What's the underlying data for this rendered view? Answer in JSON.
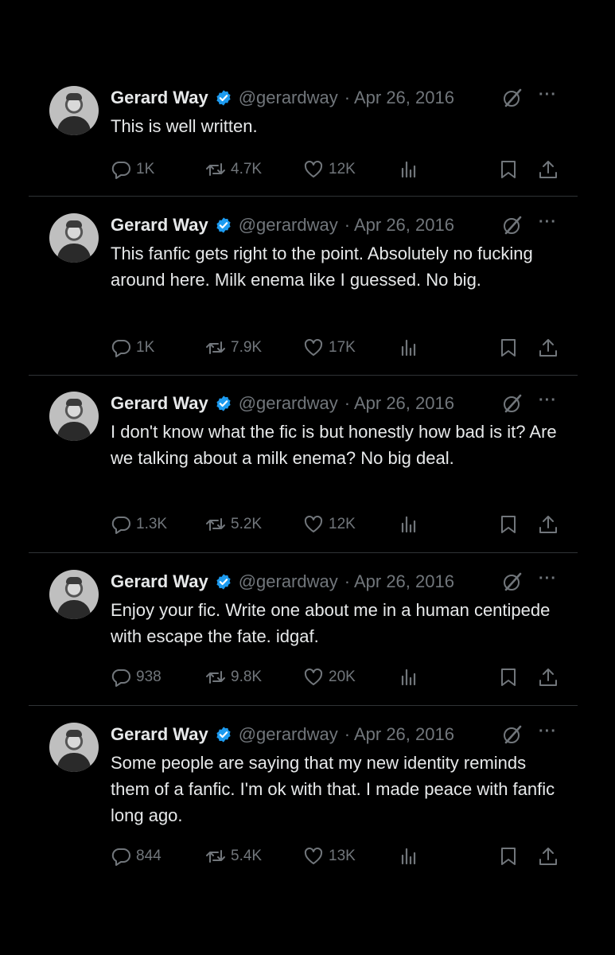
{
  "colors": {
    "background": "#000000",
    "text": "#e7e9ea",
    "muted": "#71767b",
    "verified": "#1d9bf0",
    "divider": "#2f3336"
  },
  "icons": [
    "reply-icon",
    "retweet-icon",
    "like-icon",
    "views-icon",
    "bookmark-icon",
    "share-icon",
    "verified-badge-icon",
    "grok-icon",
    "more-icon"
  ],
  "tweets": [
    {
      "author": "Gerard Way",
      "handle": "@gerardway",
      "date": "· Apr 26, 2016",
      "more": "···",
      "text": "This is well written.",
      "replies": "1K",
      "retweets": "4.7K",
      "likes": "12K"
    },
    {
      "author": "Gerard Way",
      "handle": "@gerardway",
      "date": "· Apr 26, 2016",
      "more": "···",
      "text": "This fanfic gets right to the point. Absolutely no fucking around here. Milk enema like I guessed. No big.",
      "replies": "1K",
      "retweets": "7.9K",
      "likes": "17K"
    },
    {
      "author": "Gerard Way",
      "handle": "@gerardway",
      "date": "· Apr 26, 2016",
      "more": "···",
      "text": "I don't know what the fic is but honestly how bad is it? Are we talking about a milk enema? No big deal.",
      "replies": "1.3K",
      "retweets": "5.2K",
      "likes": "12K"
    },
    {
      "author": "Gerard Way",
      "handle": "@gerardway",
      "date": "· Apr 26, 2016",
      "more": "···",
      "text": "Enjoy your fic. Write one about me in a human centipede with escape the fate. idgaf.",
      "replies": "938",
      "retweets": "9.8K",
      "likes": "20K"
    },
    {
      "author": "Gerard Way",
      "handle": "@gerardway",
      "date": "· Apr 26, 2016",
      "more": "···",
      "text": "Some people are saying that my new identity reminds them of a fanfic. I'm ok with that. I made peace with fanfic long ago.",
      "replies": "844",
      "retweets": "5.4K",
      "likes": "13K"
    }
  ]
}
